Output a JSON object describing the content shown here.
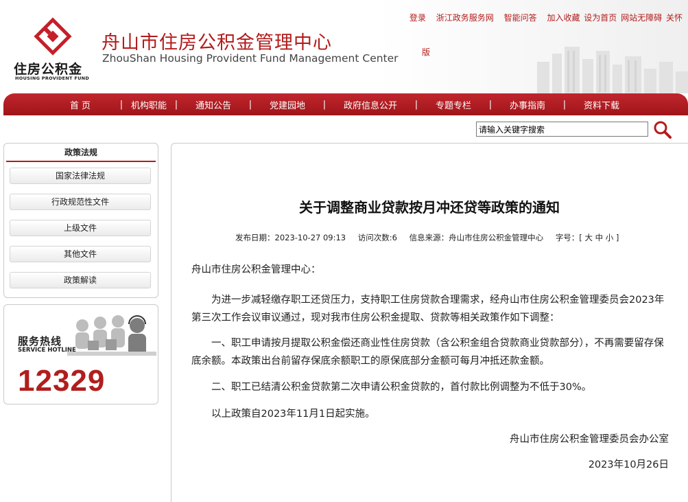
{
  "header": {
    "logo_cn": "住房公积金",
    "logo_en": "HOUSING PROVIDENT FUND",
    "title_cn": "舟山市住房公积金管理中心",
    "title_en": "ZhouShan Housing Provident Fund Management Center",
    "top_links": [
      "登录",
      "浙江政务服务网",
      "智能问答",
      "加入收藏",
      "设为首页",
      "网站无障碍",
      "关怀",
      "版"
    ]
  },
  "nav": {
    "items": [
      "首  页",
      "机构职能",
      "通知公告",
      "党建园地",
      "政府信息公开",
      "专题专栏",
      "办事指南",
      "资料下载"
    ],
    "separator": "|"
  },
  "search": {
    "placeholder": "请输入关键字搜索",
    "icon": "search-icon"
  },
  "sidebar": {
    "heading": "政策法规",
    "items": [
      "国家法律法规",
      "行政规范性文件",
      "上级文件",
      "其他文件",
      "政策解读"
    ]
  },
  "hotline": {
    "label_cn": "服务热线",
    "label_en": "SERVICE HOTLINE",
    "number": "12329"
  },
  "article": {
    "title": "关于调整商业贷款按月冲还贷等政策的通知",
    "meta": {
      "date": "发布日期：2023-10-27 09:13",
      "visits": "访问次数:6",
      "source": "信息来源：舟山市住房公积金管理中心",
      "font_size": "字号：[ 大 中 小 ]"
    },
    "salutation": "舟山市住房公积金管理中心：",
    "paragraphs": [
      "为进一步减轻缴存职工还贷压力，支持职工住房贷款合理需求，经舟山市住房公积金管理委员会2023年第三次工作会议审议通过，现对我市住房公积金提取、贷款等相关政策作如下调整：",
      "一、职工申请按月提取公积金偿还商业性住房贷款（含公积金组合贷款商业贷款部分），不再需要留存保底余额。本政策出台前留存保底余额职工的原保底部分金额可每月冲抵还款金额。",
      "二、职工已结清公积金贷款第二次申请公积金贷款的，首付款比例调整为不低于30%。",
      "以上政策自2023年11月1日起实施。"
    ],
    "signature": "舟山市住房公积金管理委员会办公室",
    "sign_date": "2023年10月26日"
  },
  "colors": {
    "brand_red": "#b31b1b",
    "nav_red": "#b01c22"
  }
}
